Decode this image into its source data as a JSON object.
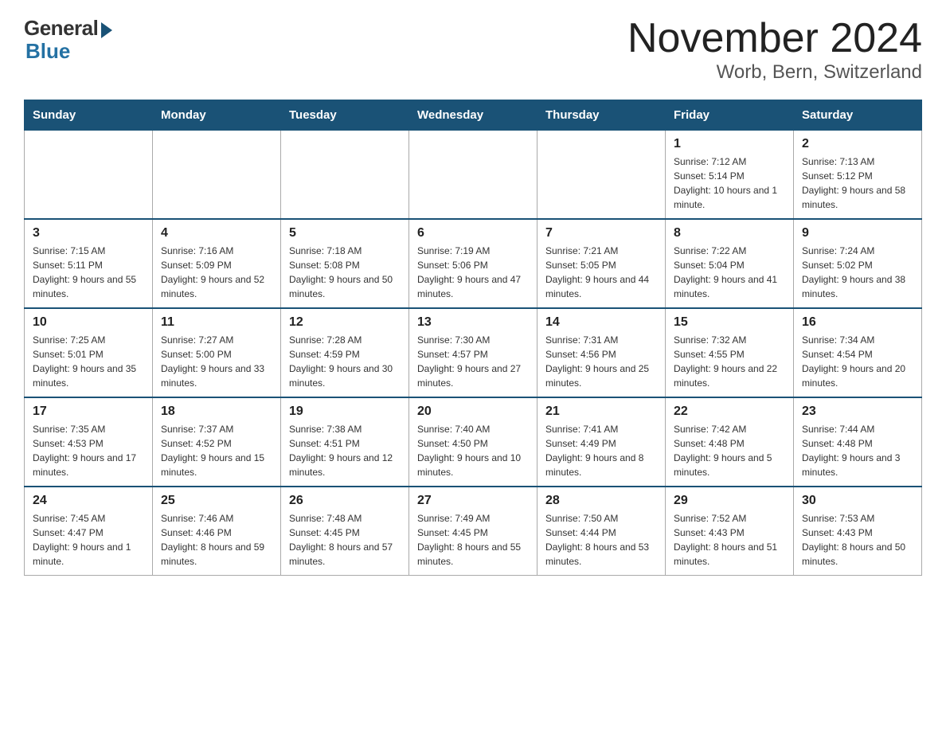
{
  "header": {
    "logo_general": "General",
    "logo_blue": "Blue",
    "month_title": "November 2024",
    "location": "Worb, Bern, Switzerland"
  },
  "weekdays": [
    "Sunday",
    "Monday",
    "Tuesday",
    "Wednesday",
    "Thursday",
    "Friday",
    "Saturday"
  ],
  "weeks": [
    [
      {
        "day": "",
        "info": ""
      },
      {
        "day": "",
        "info": ""
      },
      {
        "day": "",
        "info": ""
      },
      {
        "day": "",
        "info": ""
      },
      {
        "day": "",
        "info": ""
      },
      {
        "day": "1",
        "info": "Sunrise: 7:12 AM\nSunset: 5:14 PM\nDaylight: 10 hours and 1 minute."
      },
      {
        "day": "2",
        "info": "Sunrise: 7:13 AM\nSunset: 5:12 PM\nDaylight: 9 hours and 58 minutes."
      }
    ],
    [
      {
        "day": "3",
        "info": "Sunrise: 7:15 AM\nSunset: 5:11 PM\nDaylight: 9 hours and 55 minutes."
      },
      {
        "day": "4",
        "info": "Sunrise: 7:16 AM\nSunset: 5:09 PM\nDaylight: 9 hours and 52 minutes."
      },
      {
        "day": "5",
        "info": "Sunrise: 7:18 AM\nSunset: 5:08 PM\nDaylight: 9 hours and 50 minutes."
      },
      {
        "day": "6",
        "info": "Sunrise: 7:19 AM\nSunset: 5:06 PM\nDaylight: 9 hours and 47 minutes."
      },
      {
        "day": "7",
        "info": "Sunrise: 7:21 AM\nSunset: 5:05 PM\nDaylight: 9 hours and 44 minutes."
      },
      {
        "day": "8",
        "info": "Sunrise: 7:22 AM\nSunset: 5:04 PM\nDaylight: 9 hours and 41 minutes."
      },
      {
        "day": "9",
        "info": "Sunrise: 7:24 AM\nSunset: 5:02 PM\nDaylight: 9 hours and 38 minutes."
      }
    ],
    [
      {
        "day": "10",
        "info": "Sunrise: 7:25 AM\nSunset: 5:01 PM\nDaylight: 9 hours and 35 minutes."
      },
      {
        "day": "11",
        "info": "Sunrise: 7:27 AM\nSunset: 5:00 PM\nDaylight: 9 hours and 33 minutes."
      },
      {
        "day": "12",
        "info": "Sunrise: 7:28 AM\nSunset: 4:59 PM\nDaylight: 9 hours and 30 minutes."
      },
      {
        "day": "13",
        "info": "Sunrise: 7:30 AM\nSunset: 4:57 PM\nDaylight: 9 hours and 27 minutes."
      },
      {
        "day": "14",
        "info": "Sunrise: 7:31 AM\nSunset: 4:56 PM\nDaylight: 9 hours and 25 minutes."
      },
      {
        "day": "15",
        "info": "Sunrise: 7:32 AM\nSunset: 4:55 PM\nDaylight: 9 hours and 22 minutes."
      },
      {
        "day": "16",
        "info": "Sunrise: 7:34 AM\nSunset: 4:54 PM\nDaylight: 9 hours and 20 minutes."
      }
    ],
    [
      {
        "day": "17",
        "info": "Sunrise: 7:35 AM\nSunset: 4:53 PM\nDaylight: 9 hours and 17 minutes."
      },
      {
        "day": "18",
        "info": "Sunrise: 7:37 AM\nSunset: 4:52 PM\nDaylight: 9 hours and 15 minutes."
      },
      {
        "day": "19",
        "info": "Sunrise: 7:38 AM\nSunset: 4:51 PM\nDaylight: 9 hours and 12 minutes."
      },
      {
        "day": "20",
        "info": "Sunrise: 7:40 AM\nSunset: 4:50 PM\nDaylight: 9 hours and 10 minutes."
      },
      {
        "day": "21",
        "info": "Sunrise: 7:41 AM\nSunset: 4:49 PM\nDaylight: 9 hours and 8 minutes."
      },
      {
        "day": "22",
        "info": "Sunrise: 7:42 AM\nSunset: 4:48 PM\nDaylight: 9 hours and 5 minutes."
      },
      {
        "day": "23",
        "info": "Sunrise: 7:44 AM\nSunset: 4:48 PM\nDaylight: 9 hours and 3 minutes."
      }
    ],
    [
      {
        "day": "24",
        "info": "Sunrise: 7:45 AM\nSunset: 4:47 PM\nDaylight: 9 hours and 1 minute."
      },
      {
        "day": "25",
        "info": "Sunrise: 7:46 AM\nSunset: 4:46 PM\nDaylight: 8 hours and 59 minutes."
      },
      {
        "day": "26",
        "info": "Sunrise: 7:48 AM\nSunset: 4:45 PM\nDaylight: 8 hours and 57 minutes."
      },
      {
        "day": "27",
        "info": "Sunrise: 7:49 AM\nSunset: 4:45 PM\nDaylight: 8 hours and 55 minutes."
      },
      {
        "day": "28",
        "info": "Sunrise: 7:50 AM\nSunset: 4:44 PM\nDaylight: 8 hours and 53 minutes."
      },
      {
        "day": "29",
        "info": "Sunrise: 7:52 AM\nSunset: 4:43 PM\nDaylight: 8 hours and 51 minutes."
      },
      {
        "day": "30",
        "info": "Sunrise: 7:53 AM\nSunset: 4:43 PM\nDaylight: 8 hours and 50 minutes."
      }
    ]
  ]
}
